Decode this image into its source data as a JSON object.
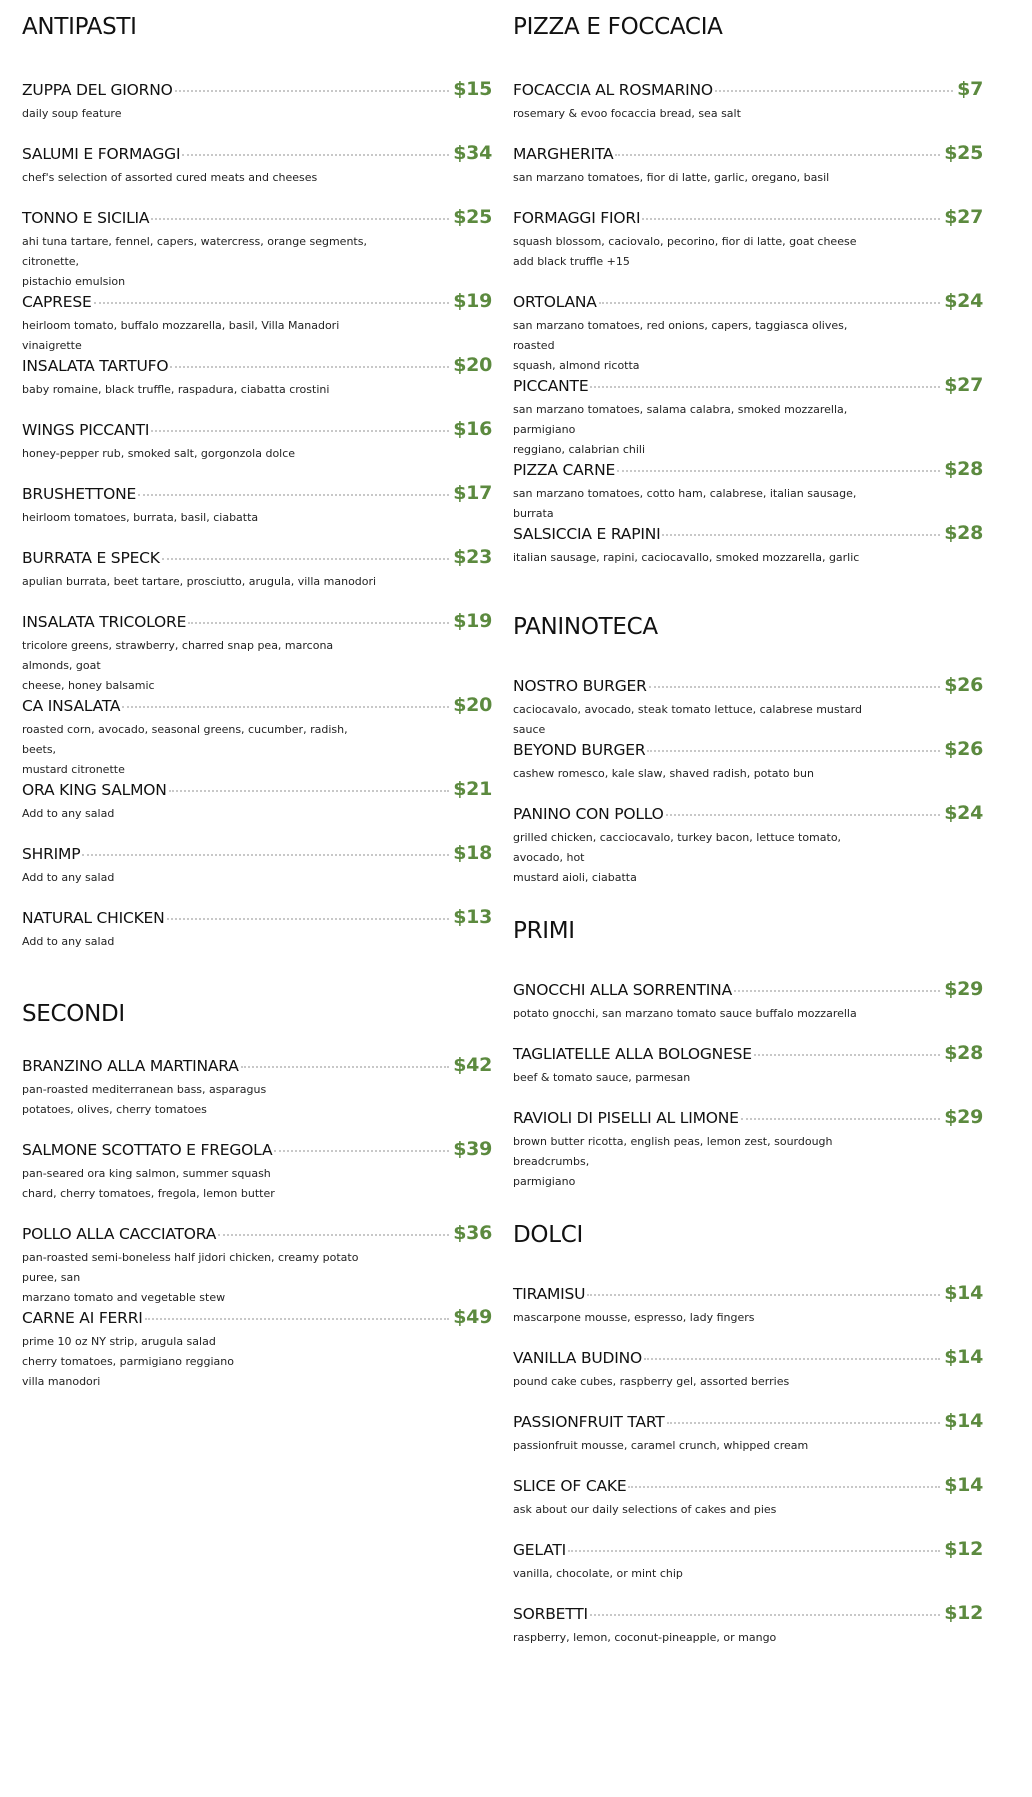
{
  "sections": {
    "antipasti": {
      "title": "ANTIPASTI",
      "items": [
        {
          "name": "ZUPPA DEL GIORNO",
          "price": "$15",
          "desc": "daily soup feature"
        },
        {
          "name": "SALUMI E FORMAGGI",
          "price": "$34",
          "desc": "chef's selection of assorted cured meats and cheeses"
        },
        {
          "name": "TONNO E SICILIA",
          "price": "$25",
          "desc": "ahi tuna tartare, fennel, capers, watercress, orange segments, citronette,\npistachio emulsion"
        },
        {
          "name": "CAPRESE",
          "price": "$19",
          "desc": "heirloom tomato, buffalo mozzarella, basil, Villa Manadori vinaigrette"
        },
        {
          "name": "INSALATA TARTUFO",
          "price": "$20",
          "desc": "baby romaine, black truffle, raspadura, ciabatta crostini"
        },
        {
          "name": "WINGS PICCANTI",
          "price": "$16",
          "desc": "honey-pepper rub, smoked salt, gorgonzola dolce"
        },
        {
          "name": "BRUSHETTONE",
          "price": "$17",
          "desc": "heirloom tomatoes, burrata, basil, ciabatta"
        },
        {
          "name": "BURRATA E SPECK",
          "price": "$23",
          "desc": "apulian burrata, beet tartare, prosciutto, arugula, villa manodori"
        },
        {
          "name": "INSALATA TRICOLORE",
          "price": "$19",
          "desc": "tricolore greens, strawberry, charred snap pea, marcona almonds, goat\ncheese, honey balsamic"
        },
        {
          "name": "CA INSALATA",
          "price": "$20",
          "desc": "roasted corn, avocado, seasonal greens, cucumber, radish, beets,\nmustard citronette"
        },
        {
          "name": "ORA KING SALMON",
          "price": "$21",
          "desc": "Add to any salad"
        },
        {
          "name": "SHRIMP",
          "price": "$18",
          "desc": "Add to any salad"
        },
        {
          "name": "NATURAL CHICKEN",
          "price": "$13",
          "desc": "Add to any salad"
        }
      ]
    },
    "secondi": {
      "title": "SECONDI",
      "items": [
        {
          "name": "BRANZINO ALLA MARTINARA",
          "price": "$42",
          "desc": "pan-roasted mediterranean bass, asparagus\npotatoes, olives, cherry tomatoes"
        },
        {
          "name": "SALMONE SCOTTATO E FREGOLA",
          "price": "$39",
          "desc": "pan-seared ora king salmon, summer squash\nchard, cherry tomatoes, fregola, lemon butter"
        },
        {
          "name": "POLLO ALLA CACCIATORA",
          "price": "$36",
          "desc": "pan-roasted semi-boneless half jidori chicken, creamy potato puree, san\nmarzano tomato and vegetable stew"
        },
        {
          "name": "CARNE AI FERRI",
          "price": "$49",
          "desc": "prime 10 oz NY strip, arugula salad\ncherry tomatoes, parmigiano reggiano\nvilla manodori"
        }
      ]
    },
    "pizza": {
      "title": "PIZZA E FOCCACIA",
      "items": [
        {
          "name": "FOCACCIA AL ROSMARINO",
          "price": "$7",
          "desc": "rosemary & evoo focaccia bread, sea salt"
        },
        {
          "name": "MARGHERITA",
          "price": "$25",
          "desc": "san marzano tomatoes, fior di latte, garlic, oregano, basil"
        },
        {
          "name": "FORMAGGI FIORI",
          "price": "$27",
          "desc": "squash blossom, caciovalo, pecorino, fior di latte, goat cheese\nadd black truffle +15"
        },
        {
          "name": "ORTOLANA",
          "price": "$24",
          "desc": "san marzano tomatoes, red onions, capers, taggiasca olives, roasted\nsquash, almond ricotta"
        },
        {
          "name": "PICCANTE",
          "price": "$27",
          "desc": "san marzano tomatoes, salama calabra, smoked mozzarella, parmigiano\nreggiano, calabrian chili"
        },
        {
          "name": "PIZZA CARNE",
          "price": "$28",
          "desc": "san marzano tomatoes, cotto ham, calabrese, italian sausage, burrata"
        },
        {
          "name": "SALSICCIA E RAPINI",
          "price": "$28",
          "desc": "italian sausage, rapini, caciocavallo, smoked mozzarella, garlic"
        }
      ]
    },
    "paninoteca": {
      "title": "PANINOTECA",
      "items": [
        {
          "name": "NOSTRO BURGER",
          "price": "$26",
          "desc": "caciocavalo, avocado, steak tomato lettuce, calabrese mustard sauce"
        },
        {
          "name": "BEYOND BURGER",
          "price": "$26",
          "desc": "cashew romesco, kale slaw, shaved radish, potato bun"
        },
        {
          "name": "PANINO CON POLLO",
          "price": "$24",
          "desc": "grilled chicken, cacciocavalo, turkey bacon, lettuce tomato, avocado, hot\nmustard aioli, ciabatta"
        }
      ]
    },
    "primi": {
      "title": "PRIMI",
      "items": [
        {
          "name": "GNOCCHI ALLA SORRENTINA",
          "price": "$29",
          "desc": "potato gnocchi, san marzano tomato sauce buffalo mozzarella"
        },
        {
          "name": "TAGLIATELLE ALLA BOLOGNESE",
          "price": "$28",
          "desc": "beef & tomato sauce, parmesan"
        },
        {
          "name": "RAVIOLI DI PISELLI AL LIMONE",
          "price": "$29",
          "desc": "brown butter ricotta, english peas, lemon zest, sourdough breadcrumbs,\nparmigiano"
        }
      ]
    },
    "dolci": {
      "title": "DOLCI",
      "items": [
        {
          "name": "TIRAMISU",
          "price": "$14",
          "desc": "mascarpone mousse, espresso, lady fingers"
        },
        {
          "name": "VANILLA BUDINO",
          "price": "$14",
          "desc": "pound cake cubes, raspberry gel, assorted berries"
        },
        {
          "name": "PASSIONFRUIT TART",
          "price": "$14",
          "desc": "passionfruit mousse, caramel crunch, whipped cream"
        },
        {
          "name": "SLICE OF CAKE",
          "price": "$14",
          "desc": "ask about our daily selections of cakes and pies"
        },
        {
          "name": "GELATI",
          "price": "$12",
          "desc": "vanilla, chocolate, or mint chip"
        },
        {
          "name": "SORBETTI",
          "price": "$12",
          "desc": "raspberry, lemon, coconut-pineapple, or mango"
        }
      ]
    }
  },
  "colors": {
    "price": "#5c8a3f",
    "dots": "#c8c8c8",
    "text": "#111111"
  }
}
